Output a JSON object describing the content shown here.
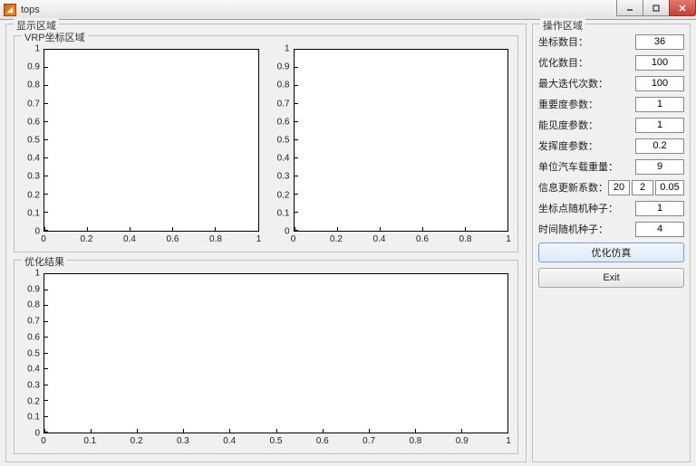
{
  "window": {
    "title": "tops",
    "icon_glyph": "📊"
  },
  "display_area": {
    "legend": "显示区域",
    "vrp_legend": "VRP坐标区域",
    "opt_legend": "优化结果"
  },
  "control_area": {
    "legend": "操作区域",
    "fields": [
      {
        "label": "坐标数目：",
        "values": [
          "36"
        ]
      },
      {
        "label": "优化数目：",
        "values": [
          "100"
        ]
      },
      {
        "label": "最大迭代次数：",
        "values": [
          "100"
        ]
      },
      {
        "label": "重要度参数：",
        "values": [
          "1"
        ]
      },
      {
        "label": "能见度参数：",
        "values": [
          "1"
        ]
      },
      {
        "label": "发挥度参数：",
        "values": [
          "0.2"
        ]
      },
      {
        "label": "单位汽车载重量：",
        "values": [
          "9"
        ]
      },
      {
        "label": "信息更新系数：",
        "values": [
          "20",
          "2",
          "0.05"
        ]
      },
      {
        "label": "坐标点随机种子：",
        "values": [
          "1"
        ]
      },
      {
        "label": "时间随机种子：",
        "values": [
          "4"
        ]
      }
    ],
    "btn_sim": "优化仿真",
    "btn_exit": "Exit"
  },
  "chart_data": [
    {
      "id": "vrp_left",
      "type": "scatter",
      "title": "",
      "xlabel": "",
      "ylabel": "",
      "xlim": [
        0,
        1
      ],
      "ylim": [
        0,
        1
      ],
      "xticks": [
        0,
        0.2,
        0.4,
        0.6,
        0.8,
        1
      ],
      "yticks": [
        0,
        0.1,
        0.2,
        0.3,
        0.4,
        0.5,
        0.6,
        0.7,
        0.8,
        0.9,
        1
      ],
      "series": [
        {
          "name": "",
          "x": [],
          "y": []
        }
      ]
    },
    {
      "id": "vrp_right",
      "type": "scatter",
      "title": "",
      "xlabel": "",
      "ylabel": "",
      "xlim": [
        0,
        1
      ],
      "ylim": [
        0,
        1
      ],
      "xticks": [
        0,
        0.2,
        0.4,
        0.6,
        0.8,
        1
      ],
      "yticks": [
        0,
        0.1,
        0.2,
        0.3,
        0.4,
        0.5,
        0.6,
        0.7,
        0.8,
        0.9,
        1
      ],
      "series": [
        {
          "name": "",
          "x": [],
          "y": []
        }
      ]
    },
    {
      "id": "opt_result",
      "type": "line",
      "title": "",
      "xlabel": "",
      "ylabel": "",
      "xlim": [
        0,
        1
      ],
      "ylim": [
        0,
        1
      ],
      "xticks": [
        0,
        0.1,
        0.2,
        0.3,
        0.4,
        0.5,
        0.6,
        0.7,
        0.8,
        0.9,
        1
      ],
      "yticks": [
        0,
        0.1,
        0.2,
        0.3,
        0.4,
        0.5,
        0.6,
        0.7,
        0.8,
        0.9,
        1
      ],
      "series": [
        {
          "name": "",
          "x": [],
          "y": []
        }
      ]
    }
  ]
}
